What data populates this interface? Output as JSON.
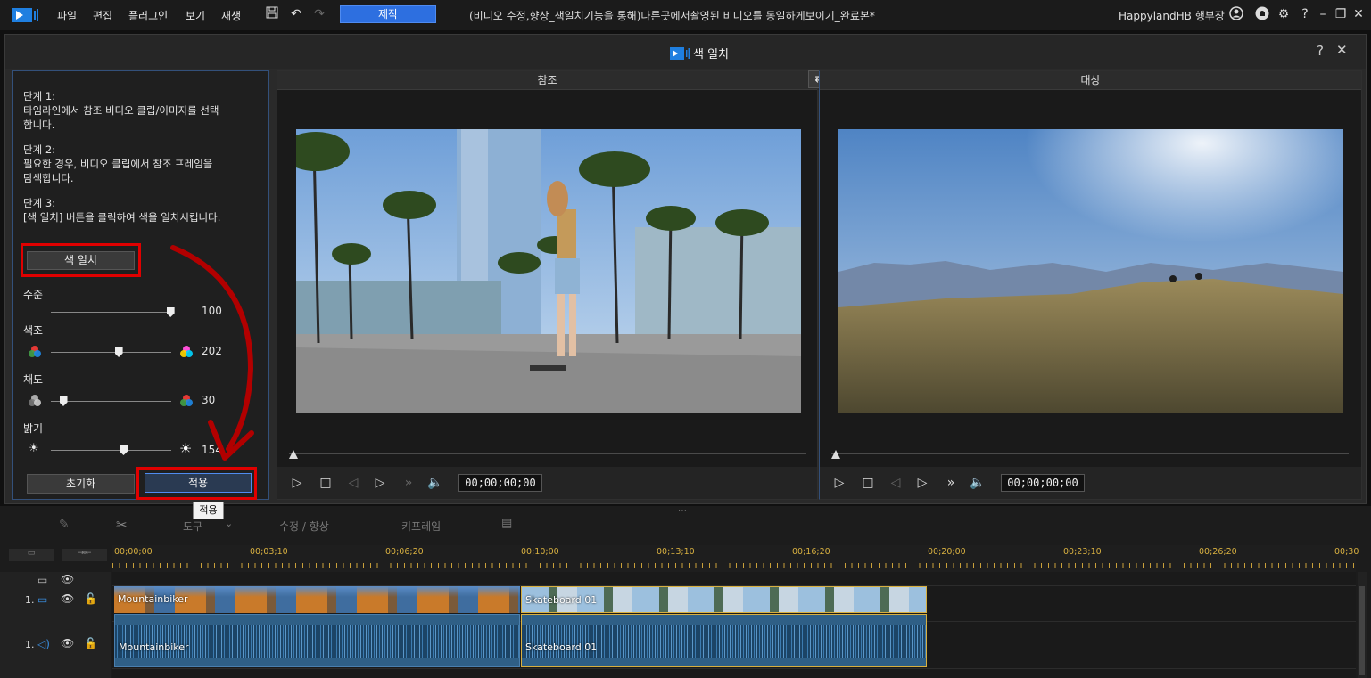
{
  "menu": [
    "파일",
    "편집",
    "플러그인",
    "보기",
    "재생"
  ],
  "produce_label": "제작",
  "doc_title": "(비디오 수정,향상_색일치기능을 통해)다른곳에서촬영된 비디오를 동일하게보이기_완료본*",
  "user_name": "HappylandHB 행부장",
  "dialog": {
    "title": "색 일치",
    "help": "?",
    "close": "✕"
  },
  "steps": [
    {
      "title": "단계 1:",
      "text": "타임라인에서 참조 비디오 클립/이미지를 선택합니다."
    },
    {
      "title": "단계 2:",
      "text": "필요한 경우, 비디오 클립에서 참조 프레임을 탐색합니다."
    },
    {
      "title": "단계 3:",
      "text": "[색 일치] 버튼을 클릭하여 색을 일치시킵니다."
    }
  ],
  "step_lines": {
    "s1a": "타임라인에서 참조 비디오 클립/이미지를 선택",
    "s1b": "합니다.",
    "s2a": "필요한 경우, 비디오 클립에서 참조 프레임을",
    "s2b": "탐색합니다.",
    "s3a": "[색 일치] 버튼을 클릭하여 색을 일치시킵니다."
  },
  "match_button": "색 일치",
  "sliders": {
    "level": {
      "label": "수준",
      "value": "100",
      "fraction": 0.99
    },
    "hue": {
      "label": "색조",
      "value": "202",
      "fraction": 0.56
    },
    "saturation": {
      "label": "채도",
      "value": "30",
      "fraction": 0.1
    },
    "brightness": {
      "label": "밝기",
      "value": "154",
      "fraction": 0.6
    }
  },
  "reset_button": "초기화",
  "apply_button": "적용",
  "apply_tooltip": "적용",
  "reference": {
    "header": "참조",
    "timecode": "00;00;00;00"
  },
  "target": {
    "header": "대상",
    "timecode": "00;00;00;00"
  },
  "timeline": {
    "tools": [
      "도구",
      "수정 / 향상",
      "키프레임"
    ],
    "ruler": [
      "00;00;00",
      "00;03;10",
      "00;06;20",
      "00;10;00",
      "00;13;10",
      "00;16;20",
      "00;20;00",
      "00;23;10",
      "00;26;20",
      "00;30"
    ],
    "tracks": [
      {
        "num": "1.",
        "type": "video"
      },
      {
        "num": "1.",
        "type": "audio"
      }
    ],
    "clips": {
      "video1": "Mountainbiker",
      "video2": "Skateboard 01",
      "audio1": "Mountainbiker",
      "audio2": "Skateboard 01"
    }
  },
  "colors": {
    "accent": "#2d6fe0",
    "highlight": "#e00000",
    "ruler_text": "#d8b040",
    "audio_clip": "#2f5f86"
  }
}
